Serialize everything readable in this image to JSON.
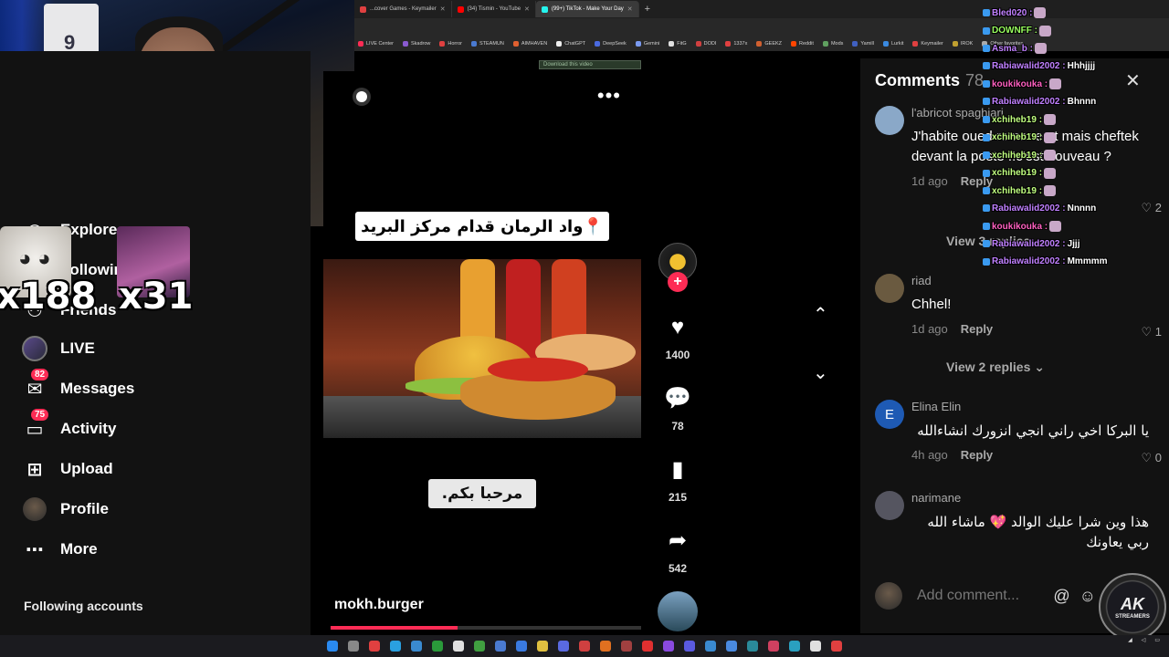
{
  "browser": {
    "tabs": [
      {
        "label": "...cover Games - Keymailer",
        "color": "#e04040",
        "active": false
      },
      {
        "label": "(34) Tismin - YouTube",
        "color": "#ff0000",
        "active": false
      },
      {
        "label": "(99+) TikTok - Make Your Day",
        "color": "#25f4ee",
        "active": true
      }
    ],
    "bookmarks": [
      {
        "label": "LIVE Center",
        "color": "#fe2c55"
      },
      {
        "label": "Skadrow",
        "color": "#8a5ad0"
      },
      {
        "label": "Horror",
        "color": "#e04040"
      },
      {
        "label": "STEAMUN",
        "color": "#4a7ad0"
      },
      {
        "label": "AIMHAVEN",
        "color": "#e06030"
      },
      {
        "label": "ChatGPT",
        "color": "#eeeeee"
      },
      {
        "label": "DeepSeek",
        "color": "#4a6ae0"
      },
      {
        "label": "Gemini",
        "color": "#7a9af0"
      },
      {
        "label": "FitG",
        "color": "#e0e0e0"
      },
      {
        "label": "DODI",
        "color": "#d04040"
      },
      {
        "label": "1337x",
        "color": "#e04040"
      },
      {
        "label": "GEEKZ",
        "color": "#d06030"
      },
      {
        "label": "Reddit",
        "color": "#ff4500"
      },
      {
        "label": "Mods",
        "color": "#60a060"
      },
      {
        "label": "Yamill",
        "color": "#4060c0"
      },
      {
        "label": "Lurkit",
        "color": "#3a8ae0"
      },
      {
        "label": "Keymailer",
        "color": "#e04040"
      },
      {
        "label": "IROK",
        "color": "#c0a030"
      },
      {
        "label": "Other favorites",
        "color": "#aaaaaa"
      }
    ],
    "download_banner": "Download this video"
  },
  "overlay": {
    "multiplier_left": "x188",
    "multiplier_right": "x31"
  },
  "sidebar": {
    "items": [
      {
        "label": "Explore",
        "icon": "compass-icon"
      },
      {
        "label": "Following",
        "icon": "following-icon"
      },
      {
        "label": "Friends",
        "icon": "friends-icon"
      },
      {
        "label": "LIVE",
        "icon": "live-icon"
      },
      {
        "label": "Messages",
        "icon": "messages-icon",
        "badge": "82"
      },
      {
        "label": "Activity",
        "icon": "activity-icon",
        "badge": "75"
      },
      {
        "label": "Upload",
        "icon": "upload-icon"
      },
      {
        "label": "Profile",
        "icon": "profile-icon"
      },
      {
        "label": "More",
        "icon": "more-icon"
      }
    ],
    "following_title": "Following accounts"
  },
  "video": {
    "caption_top": "📍واد الرمان قدام مركز البريد",
    "caption_bottom": "مرحبا بكم.",
    "username": "mokh.burger",
    "progress": 0.41,
    "likes": "1400",
    "comments": "78",
    "saves": "215",
    "shares": "542"
  },
  "comments": {
    "title": "Comments",
    "count": "78",
    "input_placeholder": "Add comment...",
    "items": [
      {
        "user": "l'abricot spaghiari",
        "text": "J'habite oued romane et mais cheftek devant la poste !!c'est nouveau ?",
        "time": "1d ago",
        "reply": "Reply",
        "likes": "2",
        "view_replies": "View 3 replies",
        "rtl": false,
        "avatar_color": "#8aa8c8"
      },
      {
        "user": "riad",
        "text": "Chhel!",
        "time": "1d ago",
        "reply": "Reply",
        "likes": "1",
        "view_replies": "View 2 replies",
        "rtl": false,
        "avatar_color": "#6a5a40"
      },
      {
        "user": "Elina Elin",
        "text": "يا البركا اخي راني انجي انزورك انشاءالله",
        "time": "4h ago",
        "reply": "Reply",
        "likes": "0",
        "view_replies": "",
        "rtl": true,
        "avatar_color": "#1e5ab4",
        "initial": "E"
      },
      {
        "user": "narimane",
        "text": "هذا وين شرا عليك الوالد 💖 ماشاء الله ربي يعاونك",
        "time": "",
        "reply": "",
        "likes": "",
        "view_replies": "",
        "rtl": true,
        "avatar_color": "#555560"
      }
    ]
  },
  "chat": [
    {
      "user": "Bled020",
      "msg": "",
      "color": "#c080ff"
    },
    {
      "user": "DOWNFF",
      "msg": "",
      "color": "#9aff60"
    },
    {
      "user": "Asma_b",
      "msg": "",
      "color": "#c080ff"
    },
    {
      "user": "Rabiawalid2002",
      "msg": "Hhhjjjj",
      "color": "#c080ff"
    },
    {
      "user": "koukikouka",
      "msg": "",
      "color": "#ff60c0"
    },
    {
      "user": "Rabiawalid2002",
      "msg": "Bhnnn",
      "color": "#c080ff"
    },
    {
      "user": "xchiheb19",
      "msg": "",
      "color": "#c0ff80"
    },
    {
      "user": "xchiheb19",
      "msg": "",
      "color": "#c0ff80"
    },
    {
      "user": "xchiheb19",
      "msg": "",
      "color": "#c0ff80"
    },
    {
      "user": "xchiheb19",
      "msg": "",
      "color": "#c0ff80"
    },
    {
      "user": "xchiheb19",
      "msg": "",
      "color": "#c0ff80"
    },
    {
      "user": "Rabiawalid2002",
      "msg": "Nnnnn",
      "color": "#c080ff"
    },
    {
      "user": "koukikouka",
      "msg": "",
      "color": "#ff60c0"
    },
    {
      "user": "Rabiawalid2002",
      "msg": "Jjjj",
      "color": "#c080ff"
    },
    {
      "user": "Rabiawalid2002",
      "msg": "Mmmmm",
      "color": "#c080ff"
    }
  ],
  "logo": {
    "big": "AK",
    "small": "STREAMERS"
  },
  "colors": {
    "accent": "#fe2c55",
    "panel": "#121212"
  }
}
